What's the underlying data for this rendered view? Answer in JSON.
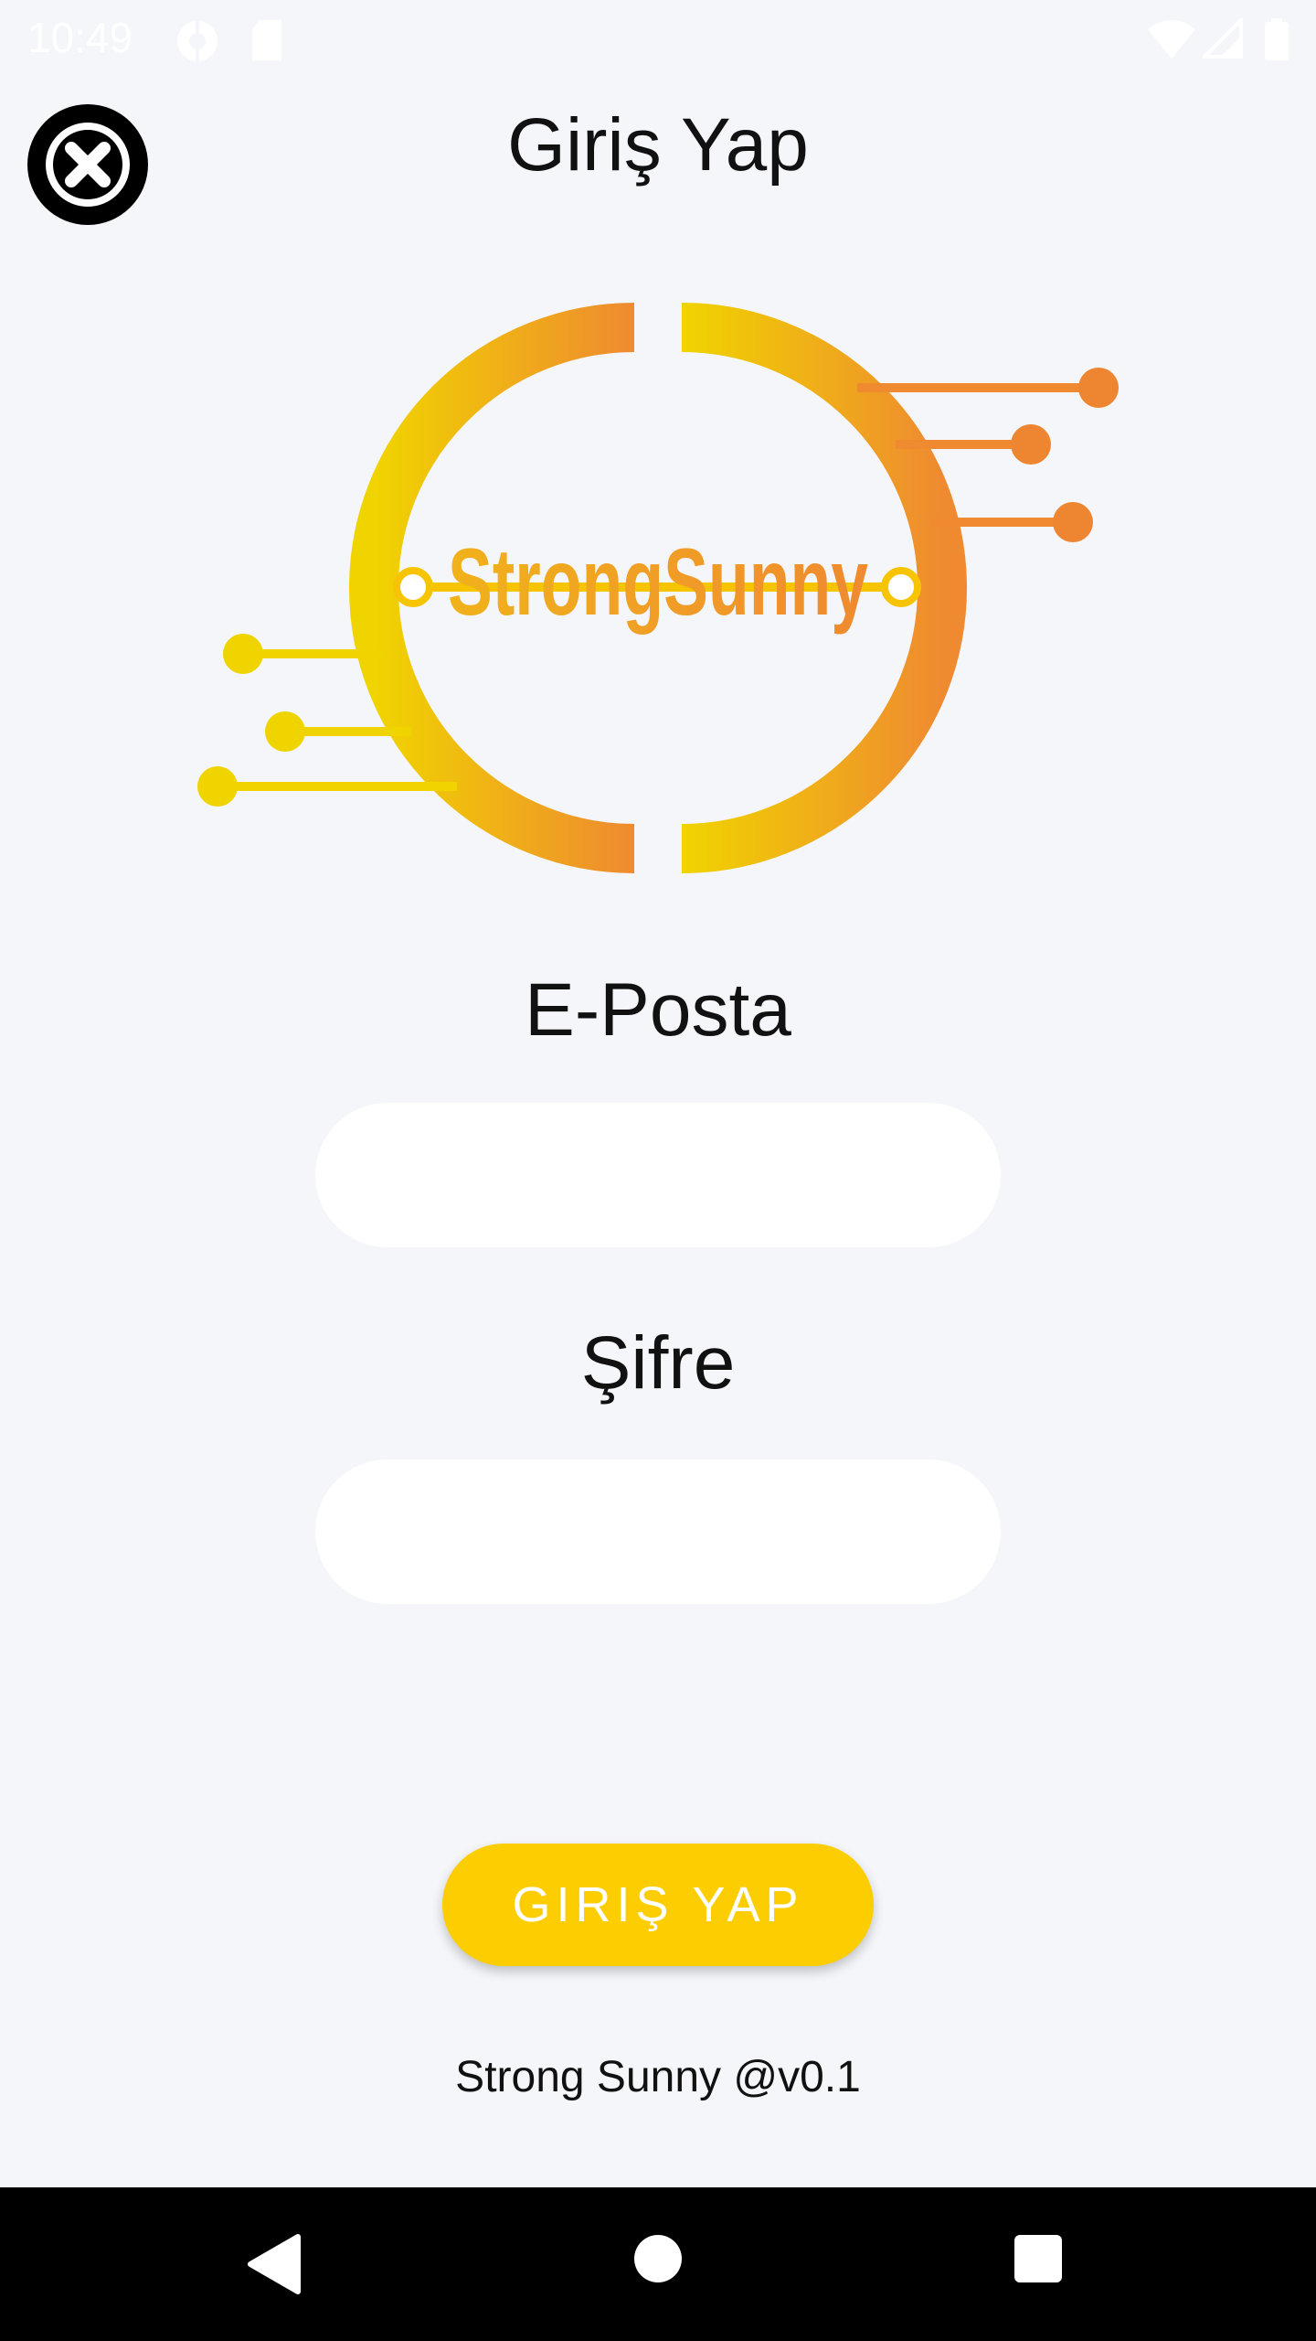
{
  "status_bar": {
    "time": "10:49",
    "icons": [
      "settings-cog-icon",
      "sd-card-icon",
      "wifi-icon",
      "cell-signal-icon",
      "battery-icon"
    ]
  },
  "header": {
    "title": "Giriş Yap",
    "close_icon": "close-circle-icon"
  },
  "logo": {
    "text": "StrongSunny",
    "colors": {
      "start": "#f0d400",
      "end": "#ef8a30"
    }
  },
  "form": {
    "email_label": "E-Posta",
    "email_value": "",
    "password_label": "Şifre",
    "password_value": ""
  },
  "login_button": {
    "label": "GIRIŞ YAP",
    "color": "#fccd00"
  },
  "footer": {
    "version_text": "Strong Sunny @v0.1"
  },
  "nav_bar": {
    "buttons": [
      "back-triangle-icon",
      "home-circle-icon",
      "recents-square-icon"
    ]
  }
}
